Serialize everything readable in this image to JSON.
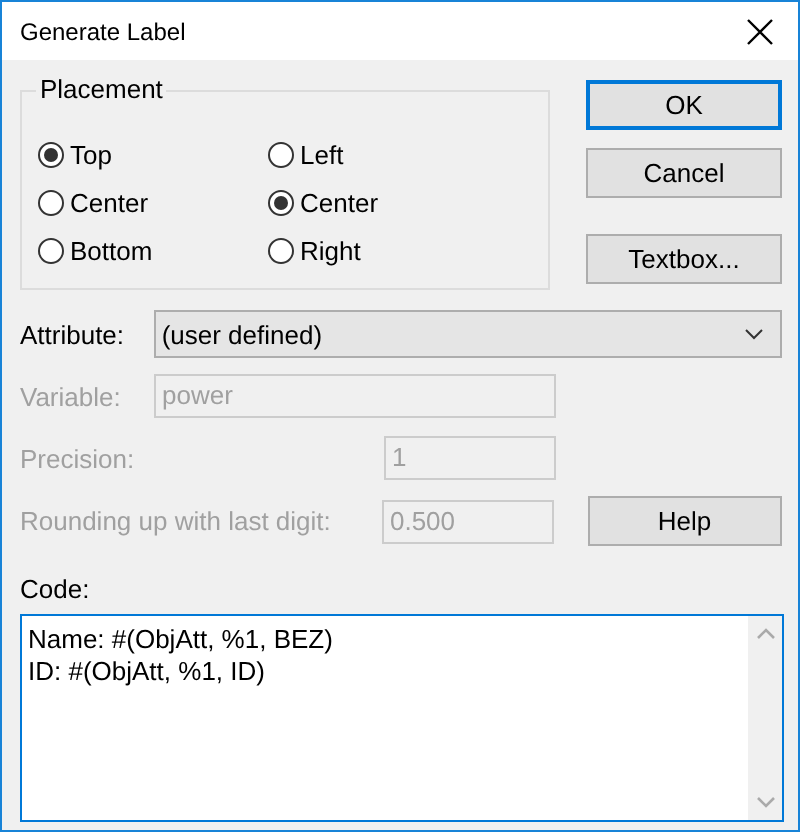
{
  "window": {
    "title": "Generate Label"
  },
  "placement": {
    "label": "Placement",
    "columns": [
      [
        {
          "label": "Top",
          "selected": true
        },
        {
          "label": "Center",
          "selected": false
        },
        {
          "label": "Bottom",
          "selected": false
        }
      ],
      [
        {
          "label": "Left",
          "selected": false
        },
        {
          "label": "Center",
          "selected": true
        },
        {
          "label": "Right",
          "selected": false
        }
      ]
    ]
  },
  "buttons": [
    {
      "label": "OK",
      "default": true
    },
    {
      "label": "Cancel",
      "default": false
    },
    {
      "label": "Textbox...",
      "default": false
    }
  ],
  "attribute": {
    "label": "Attribute:",
    "value": "(user defined)"
  },
  "fields": [
    {
      "label": "Variable:",
      "value": "power",
      "disabled": true
    },
    {
      "label": "Precision:",
      "value": "1",
      "disabled": true
    },
    {
      "label": "Rounding up with last digit:",
      "value": "0.500",
      "disabled": true
    }
  ],
  "help_button": {
    "label": "Help"
  },
  "code": {
    "label": "Code:",
    "lines": [
      "Name: #(ObjAtt, %1, BEZ)",
      "ID: #(ObjAtt, %1, ID)"
    ]
  }
}
